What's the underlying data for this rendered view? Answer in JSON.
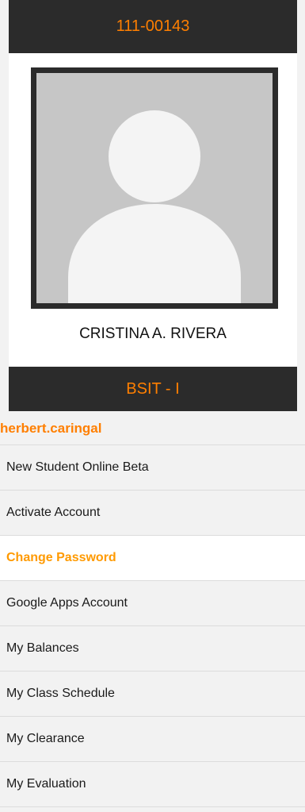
{
  "profile": {
    "student_id": "111-00143",
    "name": "CRISTINA A. RIVERA",
    "course": "BSIT - I",
    "avatar_icon": "user-silhouette-icon"
  },
  "account": {
    "username": "herbert.caringal"
  },
  "menu": [
    {
      "label": "New Student Online Beta",
      "active": false
    },
    {
      "label": "Activate Account",
      "active": false
    },
    {
      "label": "Change Password",
      "active": true
    },
    {
      "label": "Google Apps Account",
      "active": false
    },
    {
      "label": "My Balances",
      "active": false
    },
    {
      "label": "My Class Schedule",
      "active": false
    },
    {
      "label": "My Clearance",
      "active": false
    },
    {
      "label": "My Evaluation",
      "active": false
    }
  ],
  "colors": {
    "accent": "#ff7f00",
    "active_link": "#ff9a00",
    "header_bg": "#2b2b2b",
    "photo_bg": "#c6c6c6"
  }
}
